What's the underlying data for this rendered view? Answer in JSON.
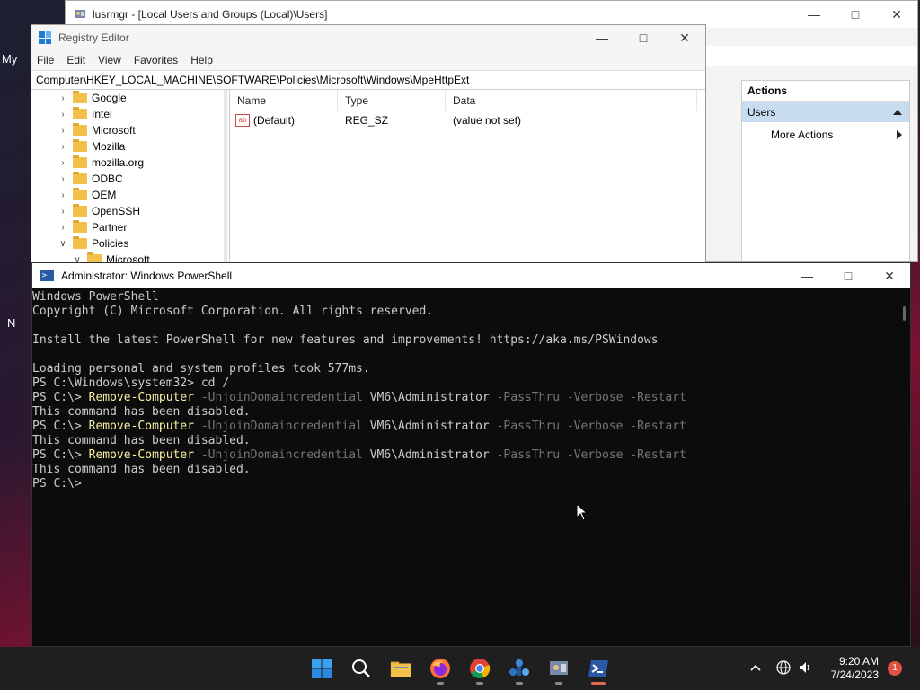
{
  "desktop": {
    "label_1": "My",
    "label_2": "N"
  },
  "lusrmgr": {
    "title": "lusrmgr - [Local Users and Groups (Local)\\Users]",
    "actions": {
      "header": "Actions",
      "selected": "Users",
      "more": "More Actions"
    }
  },
  "regedit": {
    "title": "Registry Editor",
    "menu": [
      "File",
      "Edit",
      "View",
      "Favorites",
      "Help"
    ],
    "address": "Computer\\HKEY_LOCAL_MACHINE\\SOFTWARE\\Policies\\Microsoft\\Windows\\MpeHttpExt",
    "tree": [
      {
        "label": "Google",
        "expanded": false
      },
      {
        "label": "Intel",
        "expanded": false
      },
      {
        "label": "Microsoft",
        "expanded": false
      },
      {
        "label": "Mozilla",
        "expanded": false
      },
      {
        "label": "mozilla.org",
        "expanded": false
      },
      {
        "label": "ODBC",
        "expanded": false
      },
      {
        "label": "OEM",
        "expanded": false
      },
      {
        "label": "OpenSSH",
        "expanded": false
      },
      {
        "label": "Partner",
        "expanded": false
      },
      {
        "label": "Policies",
        "expanded": true
      },
      {
        "label": "Microsoft",
        "expanded": true
      }
    ],
    "columns": [
      "Name",
      "Type",
      "Data"
    ],
    "rows": [
      {
        "name": "(Default)",
        "type": "REG_SZ",
        "data": "(value not set)"
      }
    ]
  },
  "powershell": {
    "title": "Administrator: Windows PowerShell",
    "lines": [
      [
        {
          "t": "Windows PowerShell",
          "c": ""
        }
      ],
      [
        {
          "t": "Copyright (C) Microsoft Corporation. All rights reserved.",
          "c": ""
        }
      ],
      [
        {
          "t": "",
          "c": ""
        }
      ],
      [
        {
          "t": "Install the latest PowerShell for new features and improvements! https://aka.ms/PSWindows",
          "c": ""
        }
      ],
      [
        {
          "t": "",
          "c": ""
        }
      ],
      [
        {
          "t": "Loading personal and system profiles took 577ms.",
          "c": ""
        }
      ],
      [
        {
          "t": "PS C:\\Windows\\system32> cd /",
          "c": ""
        }
      ],
      [
        {
          "t": "PS C:\\> ",
          "c": ""
        },
        {
          "t": "Remove-Computer",
          "c": "yellow"
        },
        {
          "t": " -UnjoinDomaincredential ",
          "c": "gray"
        },
        {
          "t": "VM6\\Administrator",
          "c": ""
        },
        {
          "t": " -PassThru -Verbose -Restart",
          "c": "gray"
        }
      ],
      [
        {
          "t": "This command has been disabled.",
          "c": ""
        }
      ],
      [
        {
          "t": "PS C:\\> ",
          "c": ""
        },
        {
          "t": "Remove-Computer",
          "c": "yellow"
        },
        {
          "t": " -UnjoinDomaincredential ",
          "c": "gray"
        },
        {
          "t": "VM6\\Administrator",
          "c": ""
        },
        {
          "t": " -PassThru -Verbose -Restart",
          "c": "gray"
        }
      ],
      [
        {
          "t": "This command has been disabled.",
          "c": ""
        }
      ],
      [
        {
          "t": "PS C:\\> ",
          "c": ""
        },
        {
          "t": "Remove-Computer",
          "c": "yellow"
        },
        {
          "t": " -UnjoinDomaincredential ",
          "c": "gray"
        },
        {
          "t": "VM6\\Administrator",
          "c": ""
        },
        {
          "t": " -PassThru -Verbose -Restart",
          "c": "gray"
        }
      ],
      [
        {
          "t": "This command has been disabled.",
          "c": ""
        }
      ],
      [
        {
          "t": "PS C:\\>",
          "c": ""
        }
      ]
    ]
  },
  "taskbar": {
    "icons": [
      "windows-start-icon",
      "search-icon",
      "file-explorer-icon",
      "firefox-icon",
      "chrome-icon",
      "network-tool-icon",
      "lusrmgr-icon",
      "powershell-icon"
    ],
    "time": "9:20 AM",
    "date": "7/24/2023",
    "notifications": "1"
  },
  "colors": {
    "ps_background": "#0c0c0c",
    "ps_yellow": "#f9f1a5",
    "ps_gray": "#767676",
    "taskbar": "#1f1f1f"
  }
}
